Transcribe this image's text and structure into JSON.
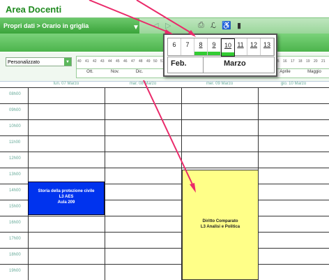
{
  "app": {
    "title": "Area Docenti"
  },
  "navbar": {
    "breadcrumb": "Propri dati > Orario in griglia"
  },
  "filter": {
    "view_select": "Personalizzato",
    "week_ticks_left": [
      "40",
      "41",
      "42",
      "43",
      "44",
      "45",
      "46",
      "47",
      "48",
      "49",
      "50",
      "51"
    ],
    "week_ticks_right": [
      "14",
      "15",
      "16",
      "17",
      "18",
      "19",
      "20",
      "21"
    ],
    "months": [
      "Ott.",
      "Nov.",
      "Dic.",
      "Aprile",
      "Maggio"
    ]
  },
  "popup": {
    "days": [
      "6",
      "7",
      "8",
      "9",
      "10",
      "11",
      "12",
      "13"
    ],
    "months": [
      "Feb.",
      "Marzo"
    ]
  },
  "calendar": {
    "day_headers": [
      "lun. 07 Marzo",
      "mar. 08 Marzo",
      "mer. 09 Marzo",
      "gio. 10 Marzo"
    ],
    "hours": [
      "08h00",
      "09h00",
      "10h00",
      "11h00",
      "12h00",
      "13h00",
      "14h00",
      "15h00",
      "16h00",
      "17h00",
      "18h00",
      "19h00"
    ]
  },
  "events": [
    {
      "line1": "Storia della protezione civile",
      "line2": "L3 AES",
      "line3": "Aula 209",
      "color": "#0033ee"
    },
    {
      "line1": "Diritto Comparato",
      "line2": "L3 Analisi e Politica",
      "color": "#ffff88"
    }
  ],
  "annotation_color": "#ea2a6a"
}
